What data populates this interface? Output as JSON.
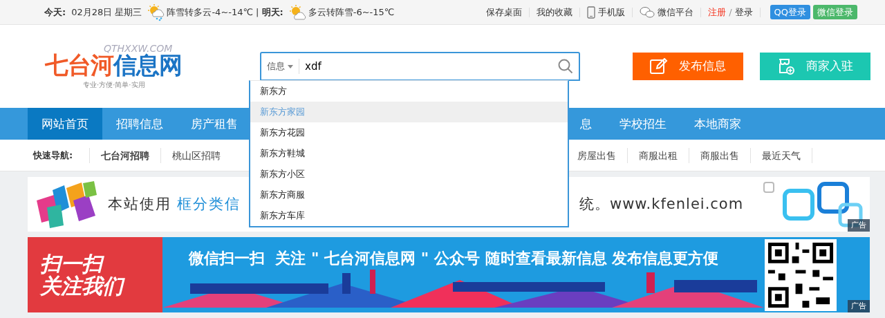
{
  "topbar": {
    "today_label": "今天:",
    "date": "02月28日 星期三",
    "today_weather": "阵雪转多云-4~-14℃",
    "divider": "|",
    "tomorrow_label": "明天:",
    "tomorrow_weather": "多云转阵雪-6~-15℃",
    "links": [
      {
        "label": "保存桌面",
        "kind": "plain"
      },
      {
        "label": "我的收藏",
        "kind": "plain"
      },
      {
        "label": "手机版",
        "kind": "phone"
      },
      {
        "label": "微信平台",
        "kind": "wechat"
      }
    ],
    "register": "注册",
    "slash": "/",
    "login": "登录",
    "buttons": [
      {
        "label": "QQ登录",
        "color": "#2f8fe0"
      },
      {
        "label": "微信登录",
        "color": "#4cb86b"
      }
    ]
  },
  "logo": {
    "domain": "QTHXXW.COM",
    "name": "七台河信息网",
    "slogan": "专业·方便·简单·实用"
  },
  "search": {
    "category": "信息",
    "value": "xdf",
    "suggestions": [
      {
        "label": "新东方",
        "selected": false
      },
      {
        "label": "新东方家园",
        "selected": true
      },
      {
        "label": "新东方花园",
        "selected": false
      },
      {
        "label": "新东方鞋城",
        "selected": false
      },
      {
        "label": "新东方小区",
        "selected": false
      },
      {
        "label": "新东方商服",
        "selected": false
      },
      {
        "label": "新东方车库",
        "selected": false
      }
    ]
  },
  "actions": [
    {
      "label": "发布信息",
      "kind": "post",
      "color": "#ff6000"
    },
    {
      "label": "商家入驻",
      "kind": "shop",
      "color": "#1cc7b1"
    }
  ],
  "nav": {
    "left": [
      {
        "label": "网站首页",
        "selected": true
      },
      {
        "label": "招聘信息",
        "selected": false
      },
      {
        "label": "房产租售",
        "selected": false
      }
    ],
    "right": [
      {
        "label": "息",
        "selected": false
      },
      {
        "label": "学校招生",
        "selected": false
      },
      {
        "label": "本地商家",
        "selected": false
      }
    ]
  },
  "quick_nav": {
    "label": "快速导航:",
    "left": [
      "七台河招聘",
      "桃山区招聘"
    ],
    "right": [
      "房屋出售",
      "商服出租",
      "商服出售",
      "最近天气"
    ]
  },
  "banner_1": {
    "text_start": "本站使用",
    "text_highlight": "框分类信",
    "text_end": "统。www.kfenlei.com",
    "ad_label": "广告"
  },
  "banner_2": {
    "badge_top": "扫一扫",
    "badge_bottom": "关注我们",
    "headline": "微信扫一扫  关注 \" 七台河信息网 \" 公众号 随时查看最新信息 发布信息更方便",
    "ad_label": "广告"
  }
}
